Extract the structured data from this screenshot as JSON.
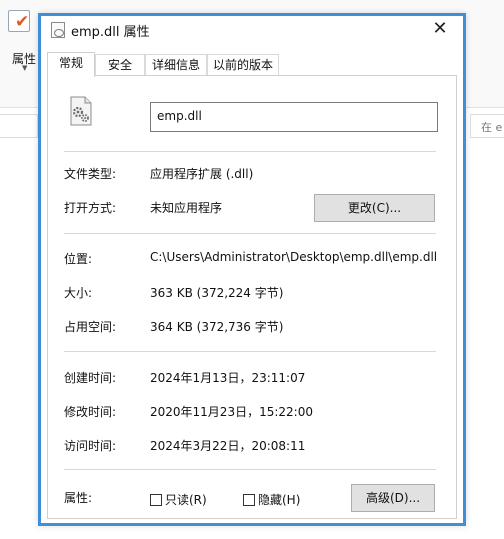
{
  "background": {
    "ribbon_label": "属性",
    "search_placeholder": "在 e"
  },
  "dialog": {
    "title": "emp.dll 属性",
    "close_symbol": "✕",
    "tabs": [
      {
        "label": "常规",
        "active": true
      },
      {
        "label": "安全",
        "active": false
      },
      {
        "label": "详细信息",
        "active": false
      },
      {
        "label": "以前的版本",
        "active": false
      }
    ],
    "general": {
      "file_name": "emp.dll",
      "file_type_label": "文件类型:",
      "file_type_value": "应用程序扩展 (.dll)",
      "opens_with_label": "打开方式:",
      "opens_with_value": "未知应用程序",
      "change_button": "更改(C)...",
      "location_label": "位置:",
      "location_value": "C:\\Users\\Administrator\\Desktop\\emp.dll\\emp.dll",
      "size_label": "大小:",
      "size_value": "363 KB (372,224 字节)",
      "size_on_disk_label": "占用空间:",
      "size_on_disk_value": "364 KB (372,736 字节)",
      "created_label": "创建时间:",
      "created_value": "2024年1月13日，23:11:07",
      "modified_label": "修改时间:",
      "modified_value": "2020年11月23日，15:22:00",
      "accessed_label": "访问时间:",
      "accessed_value": "2024年3月22日，20:08:11",
      "attributes_label": "属性:",
      "readonly_label": "只读(R)",
      "readonly_checked": false,
      "hidden_label": "隐藏(H)",
      "hidden_checked": false,
      "advanced_button": "高级(D)..."
    }
  },
  "colors": {
    "dialog_border": "#3d8fd6",
    "button_bg": "#e1e1e1",
    "ribbon_check": "#e05a1c"
  }
}
